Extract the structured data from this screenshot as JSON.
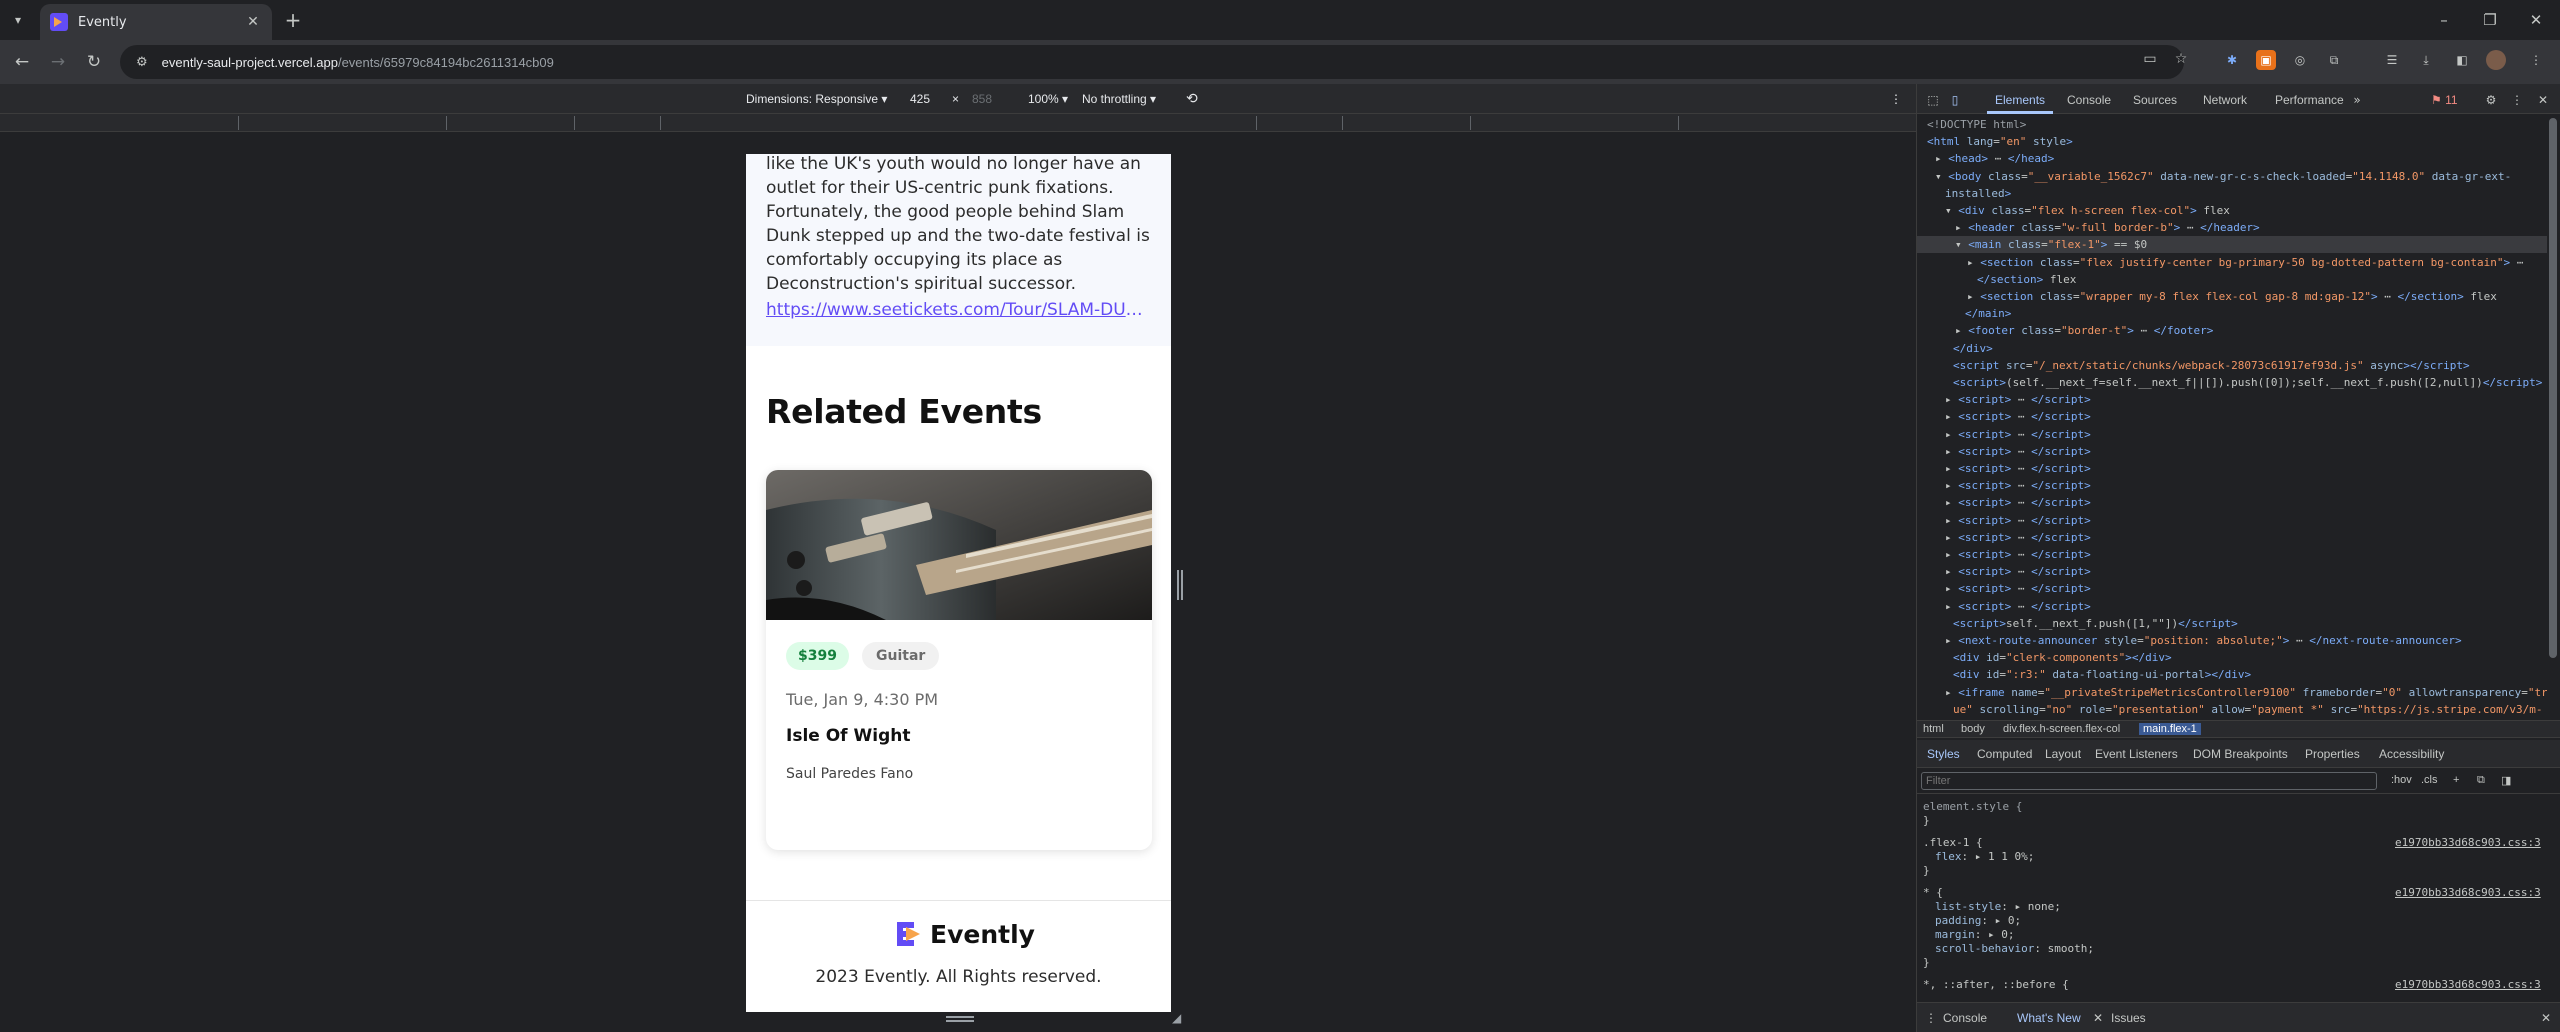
{
  "browser": {
    "tab_title": "Evently",
    "url_host": "evently-saul-project.vercel.app",
    "url_path": "/events/65979c84194bc2611314cb09"
  },
  "device_toolbar": {
    "dimensions_label": "Dimensions: Responsive",
    "width": "425",
    "times": "×",
    "height": "858",
    "zoom": "100%",
    "throttling": "No throttling"
  },
  "page": {
    "description": "like the UK's youth would no longer have an outlet for their US-centric punk fixations. Fortunately, the good people behind Slam Dunk stepped up and the two-date festival is comfortably occupying its place as Deconstruction's spiritual successor.",
    "link": "https://www.seetickets.com/Tour/SLAM-DUNK-FESTIVAL",
    "related_heading": "Related Events",
    "event": {
      "price": "$399",
      "category": "Guitar",
      "date": "Tue, Jan 9, 4:30 PM",
      "title": "Isle Of Wight",
      "organizer": "Saul Paredes Fano"
    },
    "footer": {
      "logo_text": "Evently",
      "copyright": "2023 Evently. All Rights reserved."
    }
  },
  "devtools": {
    "tabs": [
      "Elements",
      "Console",
      "Sources",
      "Network",
      "Performance"
    ],
    "issues_count": "11",
    "breadcrumbs": [
      "html",
      "body",
      "div.flex.h-screen.flex-col",
      "main.flex-1"
    ],
    "styles_tabs": [
      "Styles",
      "Computed",
      "Layout",
      "Event Listeners",
      "DOM Breakpoints",
      "Properties",
      "Accessibility"
    ],
    "filter_placeholder": "Filter",
    "hov": ":hov",
    "cls": ".cls",
    "css_source": "e1970bb33d68c903.css:3",
    "drawer_tabs": [
      "Console",
      "What's New",
      "Issues"
    ]
  },
  "colors": {
    "accent": "#624cf5",
    "price_badge_bg": "#dcfce7",
    "price_badge_text": "#15803d"
  }
}
